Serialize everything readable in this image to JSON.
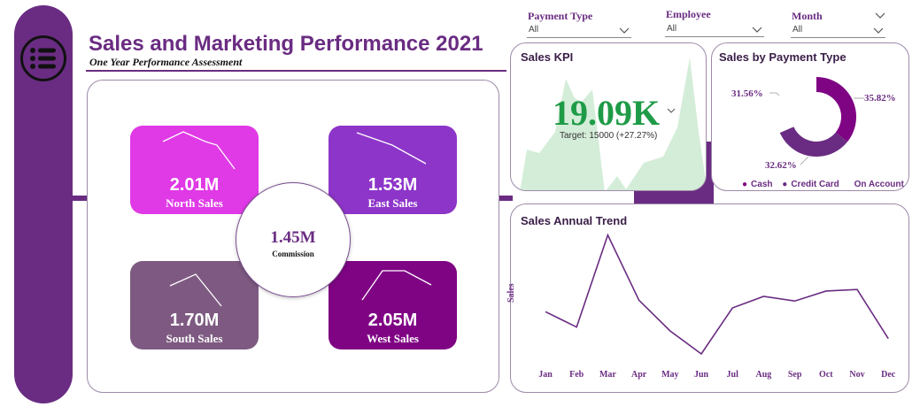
{
  "header": {
    "title": "Sales and Marketing Performance 2021",
    "subtitle": "One Year Performance Assessment"
  },
  "icons": {
    "menu": "menu-list-icon",
    "dropdown": "chevron-down-icon"
  },
  "colors": {
    "brand_purple": "#6a2c82",
    "north_tile": "#e039e6",
    "east_tile": "#8d35c9",
    "south_tile": "#7e5a82",
    "west_tile": "#7f0484",
    "kpi_green": "#1f9b47",
    "kpi_area": "#d4edd9"
  },
  "filters": [
    {
      "label": "Payment Type",
      "value": "All"
    },
    {
      "label": "Employee",
      "value": "All"
    },
    {
      "label": "Month",
      "value": "All"
    }
  ],
  "tiles": {
    "north": {
      "value": "2.01M",
      "label": "North Sales"
    },
    "east": {
      "value": "1.53M",
      "label": "East Sales"
    },
    "south": {
      "value": "1.70M",
      "label": "South Sales"
    },
    "west": {
      "value": "2.05M",
      "label": "West Sales"
    },
    "commission": {
      "value": "1.45M",
      "label": "Commission"
    }
  },
  "kpi": {
    "title": "Sales KPI",
    "value": "19.09K",
    "target_text": "Target: 15000 (+27.27%)"
  },
  "payment_type": {
    "title": "Sales by Payment Type",
    "pct_cash": "35.82%",
    "pct_credit": "32.62%",
    "pct_account": "31.56%",
    "legend_cash": "Cash",
    "legend_credit": "Credit Card",
    "legend_account": "On Account"
  },
  "trend": {
    "title": "Sales Annual Trend",
    "ylabel": "Sales"
  },
  "chart_data": [
    {
      "type": "pie",
      "title": "Sales by Payment Type",
      "categories": [
        "Cash",
        "Credit Card",
        "On Account"
      ],
      "values": [
        35.82,
        32.62,
        31.56
      ],
      "colors": [
        "#7f0484",
        "#6a2c82",
        "#ffffff"
      ],
      "legend_position": "bottom"
    },
    {
      "type": "line",
      "title": "Sales Annual Trend",
      "xlabel": "",
      "ylabel": "Sales",
      "categories": [
        "Jan",
        "Feb",
        "Mar",
        "Apr",
        "May",
        "Jun",
        "Jul",
        "Aug",
        "Sep",
        "Oct",
        "Nov",
        "Dec"
      ],
      "series": [
        {
          "values": [
            1.3,
            1.1,
            2.3,
            1.45,
            1.05,
            0.75,
            1.35,
            1.5,
            1.44,
            1.57,
            1.59,
            0.95
          ]
        }
      ],
      "grid": false
    }
  ]
}
